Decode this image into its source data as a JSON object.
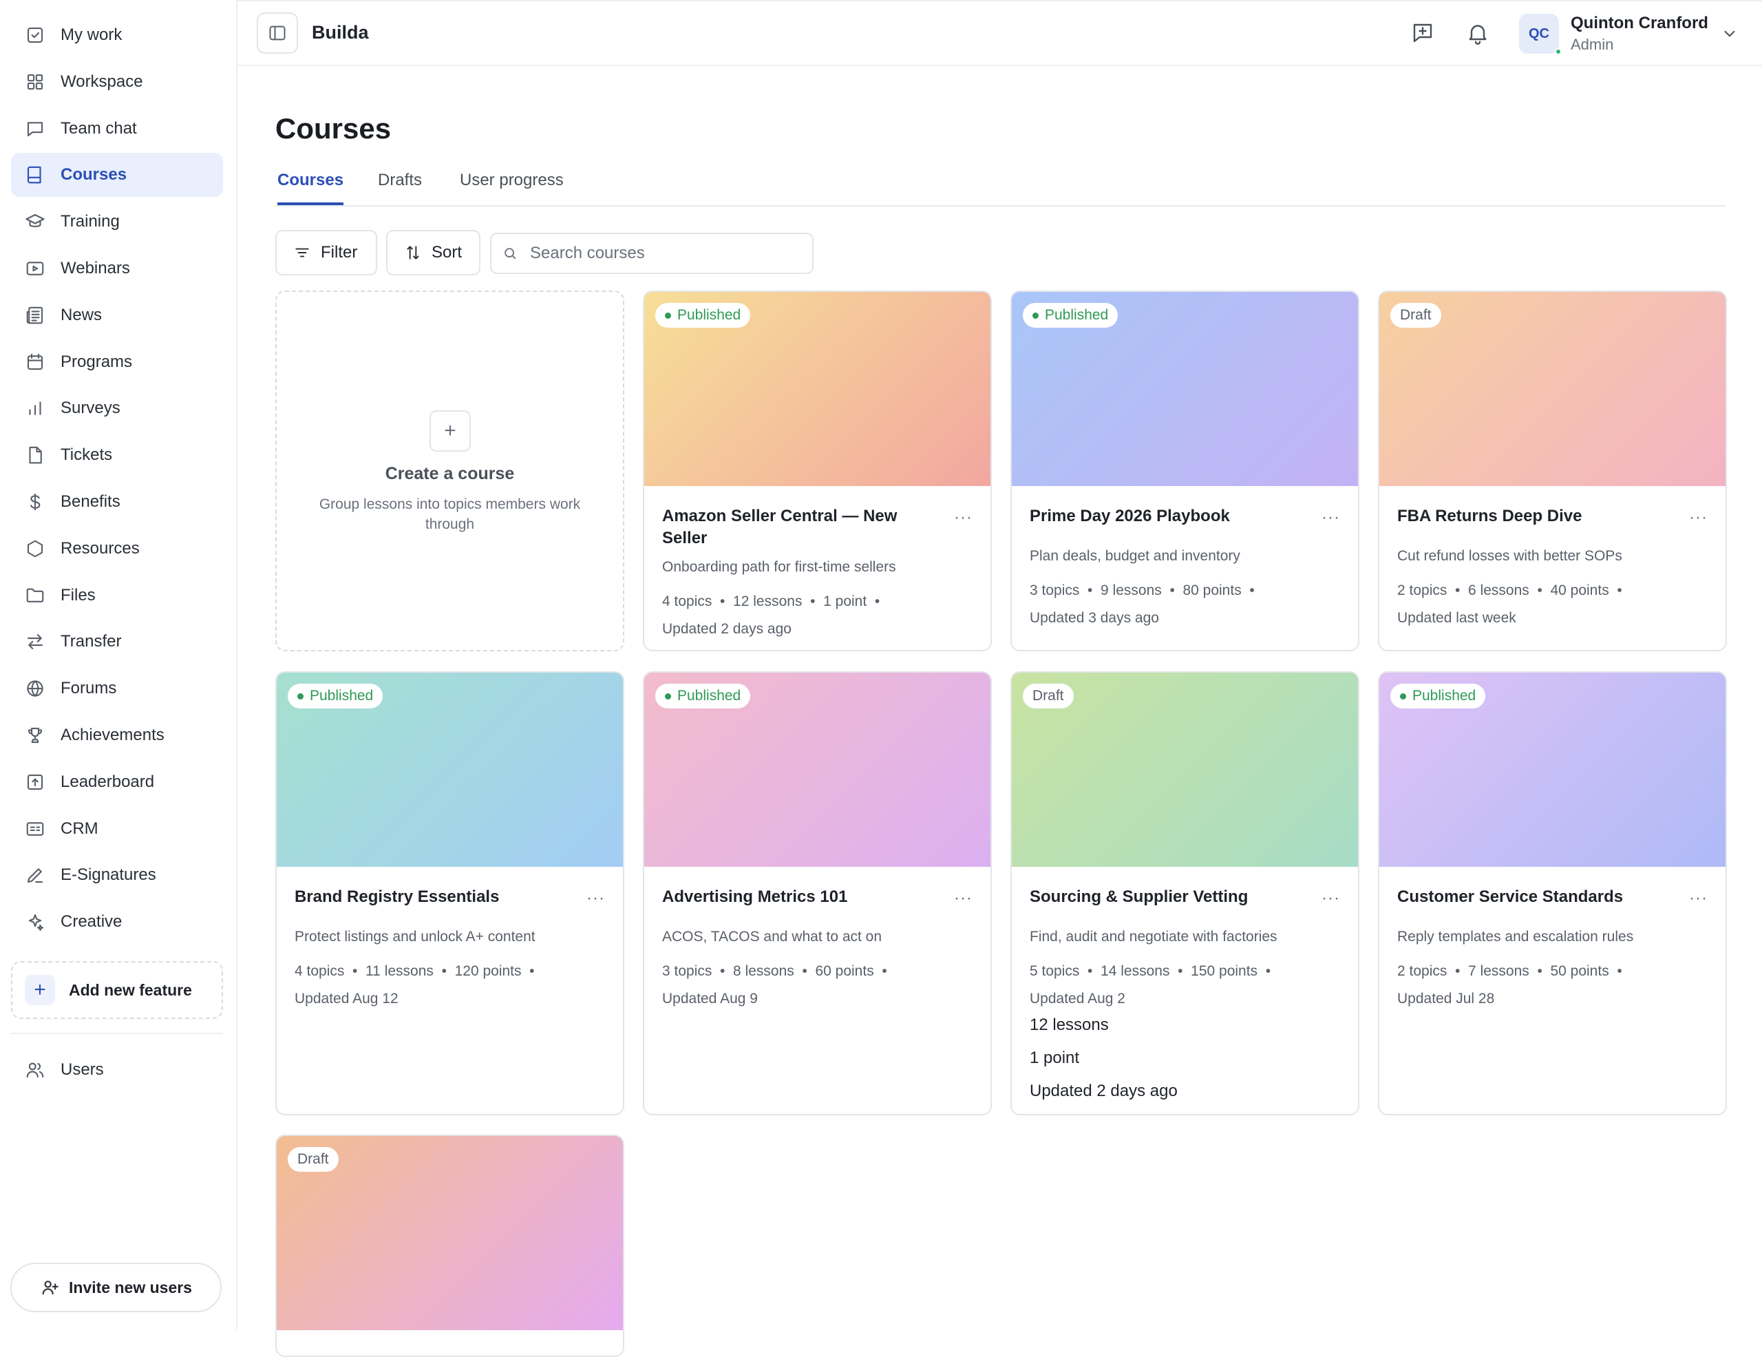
{
  "sidebar": {
    "items": [
      {
        "label": "My work",
        "icon": "checkbox-icon"
      },
      {
        "label": "Workspace",
        "icon": "grid-icon"
      },
      {
        "label": "Team chat",
        "icon": "chat-icon"
      },
      {
        "label": "Courses",
        "icon": "book-icon",
        "active": true
      },
      {
        "label": "Training",
        "icon": "graduation-cap-icon"
      },
      {
        "label": "Webinars",
        "icon": "video-icon"
      },
      {
        "label": "News",
        "icon": "newspaper-icon"
      },
      {
        "label": "Programs",
        "icon": "calendar-icon"
      },
      {
        "label": "Surveys",
        "icon": "bar-chart-icon"
      },
      {
        "label": "Tickets",
        "icon": "file-icon"
      },
      {
        "label": "Benefits",
        "icon": "dollar-icon"
      },
      {
        "label": "Resources",
        "icon": "hexagon-icon"
      },
      {
        "label": "Files",
        "icon": "folder-icon"
      },
      {
        "label": "Transfer",
        "icon": "arrows-swap-icon"
      },
      {
        "label": "Forums",
        "icon": "globe-icon"
      },
      {
        "label": "Achievements",
        "icon": "trophy-icon"
      },
      {
        "label": "Leaderboard",
        "icon": "upload-box-icon"
      },
      {
        "label": "CRM",
        "icon": "id-card-icon"
      },
      {
        "label": "E-Signatures",
        "icon": "pen-icon"
      },
      {
        "label": "Creative",
        "icon": "sparkle-icon"
      }
    ],
    "add_feature_label": "Add new feature",
    "users_label": "Users",
    "invite_label": "Invite new users"
  },
  "topbar": {
    "brand": "Builda",
    "user_initials": "QC",
    "user_name": "Quinton Cranford",
    "user_role": "Admin"
  },
  "page": {
    "title": "Courses",
    "tabs": [
      "Courses",
      "Drafts",
      "User progress"
    ],
    "filter_label": "Filter",
    "sort_label": "Sort",
    "search_placeholder": "Search courses"
  },
  "create_card": {
    "title": "Create a course",
    "description": "Group lessons into topics members work through"
  },
  "colors": {
    "accent": "#2c4fb5",
    "published": "#2f9a55"
  },
  "courses": [
    {
      "status": "Published",
      "title": "Amazon Seller Central — New Seller",
      "description": "Onboarding path for first-time sellers",
      "meta": "4 topics  •  12 lessons  •  1 point  •",
      "updated": "Updated 2 days ago",
      "gradient": [
        "#f7df97",
        "#f2a7a0"
      ]
    },
    {
      "status": "Published",
      "title": "Prime Day 2026 Playbook",
      "description": "Plan deals, budget and inventory",
      "meta": "3 topics  •  9 lessons  •  80 points  •",
      "updated": "Updated 3 days ago",
      "gradient": [
        "#a9c6f8",
        "#c3b2f5"
      ]
    },
    {
      "status": "Draft",
      "title": "FBA Returns Deep Dive",
      "description": "Cut refund losses with better SOPs",
      "meta": "2 topics  •  6 lessons  •  40 points  •",
      "updated": "Updated last week",
      "gradient": [
        "#f7d0a0",
        "#f3b3c3"
      ]
    },
    {
      "status": "Published",
      "title": "Brand Registry Essentials",
      "description": "Protect listings and unlock A+ content",
      "meta": "4 topics  •  11 lessons  •  120 points  •",
      "updated": "Updated Aug 12",
      "gradient": [
        "#a6e0cf",
        "#a2cdf5"
      ]
    },
    {
      "status": "Published",
      "title": "Advertising Metrics 101",
      "description": "ACOS, TACOS and what to act on",
      "meta": "3 topics  •  8 lessons  •  60 points  •",
      "updated": "Updated Aug 9",
      "gradient": [
        "#f3bccb",
        "#dcb0f1"
      ]
    },
    {
      "status": "Draft",
      "title": "Sourcing & Supplier Vetting",
      "description": "Find, audit and negotiate with factories",
      "meta": "5 topics  •  14 lessons  •  150 points  •",
      "updated": "Updated Aug 2",
      "extra": [
        "12 lessons",
        "1 point",
        "Updated 2 days ago"
      ],
      "gradient": [
        "#c8e3a2",
        "#a7dcc6"
      ]
    },
    {
      "status": "Published",
      "title": "Customer Service Standards",
      "description": "Reply templates and escalation rules",
      "meta": "2 topics  •  7 lessons  •  50 points  •",
      "updated": "Updated Jul 28",
      "gradient": [
        "#dfc2f5",
        "#aebaf7"
      ]
    },
    {
      "status": "Draft",
      "title": "",
      "description": "",
      "meta": "",
      "updated": "",
      "gradient": [
        "#f3bd90",
        "#e6aaf0"
      ]
    }
  ]
}
